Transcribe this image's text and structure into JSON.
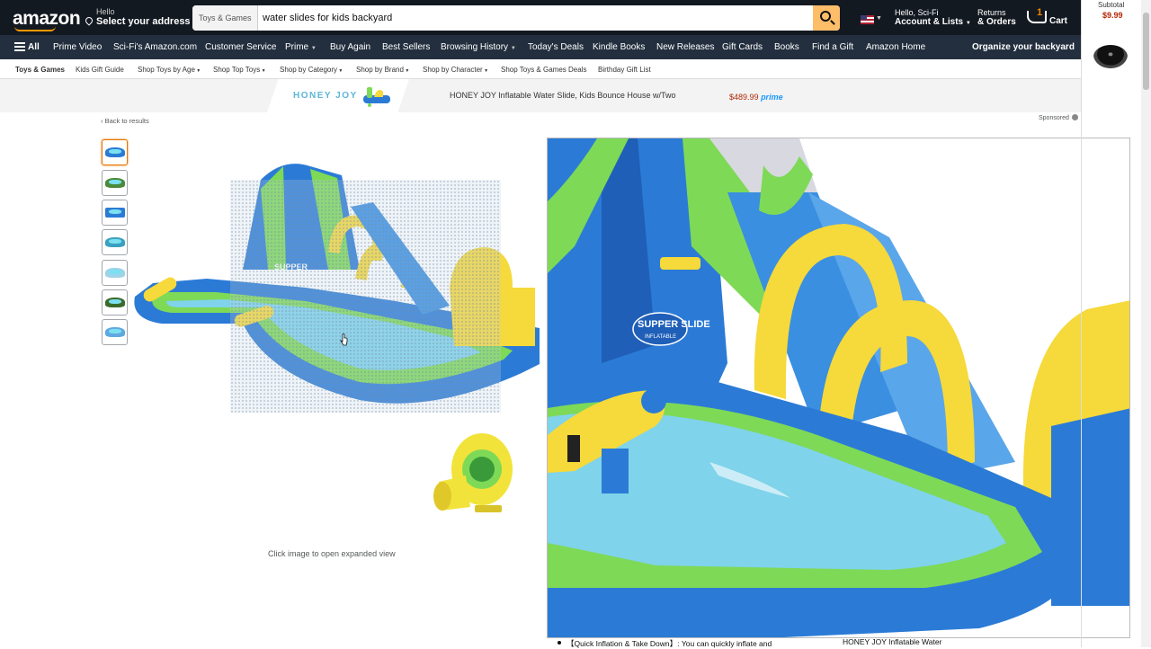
{
  "header": {
    "logo": "amazon",
    "deliver_small": "Hello",
    "deliver_big": "Select your address",
    "search_category": "Toys & Games",
    "search_value": "water slides for kids backyard",
    "account_small": "Hello, Sci-Fi",
    "account_big": "Account & Lists",
    "returns_small": "Returns",
    "returns_big": "& Orders",
    "cart_count": "1",
    "cart_label": "Cart"
  },
  "nav": {
    "all": "All",
    "items": [
      "Prime Video",
      "Sci-Fi's Amazon.com",
      "Customer Service",
      "Prime",
      "Buy Again",
      "Best Sellers",
      "Browsing History",
      "Today's Deals",
      "Kindle Books",
      "New Releases",
      "Gift Cards",
      "Books",
      "Find a Gift",
      "Amazon Home"
    ],
    "promo": "Organize your backyard"
  },
  "subnav": {
    "items": [
      "Toys & Games",
      "Kids Gift Guide",
      "Shop Toys by Age",
      "Shop Top Toys",
      "Shop by Category",
      "Shop by Brand",
      "Shop by Character",
      "Shop Toys & Games Deals",
      "Birthday Gift List"
    ]
  },
  "banner": {
    "brand": "HONEY JOY",
    "title": "HONEY JOY Inflatable Water Slide, Kids Bounce House w/Two",
    "price": "$489.99",
    "prime": "prime"
  },
  "product": {
    "back_link": "‹ Back to results",
    "sponsored": "Sponsored",
    "click_hint": "Click image to open expanded view",
    "bullet_text": "【Quick Inflation & Take Down】: You can quickly inflate and",
    "right_title": "HONEY JOY Inflatable Water"
  },
  "side_cart": {
    "label": "Subtotal",
    "value": "$9.99"
  },
  "zoom_image": {
    "slide_text": "SUPPER SLIDE",
    "slide_sub": "INFLATABLE"
  },
  "colors": {
    "nav_dark": "#131921",
    "nav_main": "#232f3e",
    "search_button": "#febd69",
    "price": "#b12704",
    "slide_blue": "#2b7bd6",
    "slide_green": "#7ed957",
    "slide_yellow": "#f6d93a",
    "water": "#7fd3ea"
  }
}
